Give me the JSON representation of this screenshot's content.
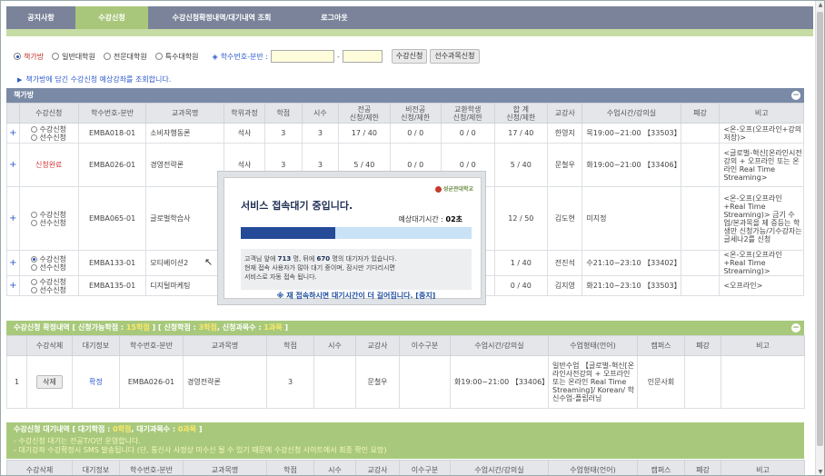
{
  "nav": {
    "tabs": [
      {
        "label": "공지사항"
      },
      {
        "label": "수강신청"
      },
      {
        "label": "수강신청확정내역/대기내역 조회"
      },
      {
        "label": "로그아웃"
      }
    ],
    "active_index": 1
  },
  "filter": {
    "radios": [
      {
        "label": "책가방",
        "checked": true
      },
      {
        "label": "일반대학원",
        "checked": false
      },
      {
        "label": "전문대학원",
        "checked": false
      },
      {
        "label": "특수대학원",
        "checked": false
      }
    ],
    "code_label": "학수번호-분반 :",
    "input1": "",
    "input2": "",
    "apply_button": "수강신청",
    "prereq_button": "선수과목신청"
  },
  "notice1": "책가방에 담긴 수강신청 예상강좌를 조회합니다.",
  "bag": {
    "title": "책가방",
    "toggle": "−",
    "headers": [
      "수강신청",
      "학수번호-분반",
      "교과목명",
      "학위과정",
      "학점",
      "시수",
      "전공\n신청/제한",
      "비전공\n신청/제한",
      "교환학생\n신청/제한",
      "합 계\n신청/제한",
      "교강사",
      "수업시간/강의실",
      "폐강",
      "비고"
    ],
    "rows": [
      {
        "state": "radio",
        "checked": "",
        "code": "EMBA018-01",
        "name": "소비자행동론",
        "course": "석사",
        "credit": "3",
        "hours": "3",
        "major": "17 / 40",
        "nonmajor": "0 / 0",
        "exchange": "0 / 0",
        "total": "17 / 40",
        "teacher": "한영지",
        "time": "목19:00~21:00 【33503】",
        "closed": "",
        "note": "<온-오프(오프라인+강의저장)>"
      },
      {
        "state": "done",
        "done_label": "신청완료",
        "code": "EMBA026-01",
        "name": "경영전략론",
        "course": "석사",
        "credit": "3",
        "hours": "3",
        "major": "5 / 40",
        "nonmajor": "0 / 0",
        "exchange": "0 / 0",
        "total": "5 / 40",
        "teacher": "문철우",
        "time": "화19:00~21:00 【33406】",
        "closed": "",
        "note": "<글로벌-혁신[온라인시전강의 + 오프라인 또는 온라인 Real Time Streaming>"
      },
      {
        "state": "radio",
        "checked": "",
        "code": "EMBA065-01",
        "name": "글로벌학습사",
        "course": "",
        "credit": "",
        "hours": "",
        "major": "",
        "nonmajor": "",
        "exchange": "",
        "total": "12 / 50",
        "teacher": "김도현",
        "time": "미지정",
        "closed": "",
        "note": "<온-오프(오프라인+Real Time Streaming)> 금기 수업/본과목을 제 증등는 학생만 신청가능/기수강자는 글세나2를 신청"
      },
      {
        "state": "radio",
        "checked": "apply",
        "code": "EMBA133-01",
        "name": "모티베이션2",
        "course": "",
        "credit": "",
        "hours": "",
        "major": "",
        "nonmajor": "",
        "exchange": "",
        "total": "1 / 40",
        "teacher": "전진석",
        "time": "수21:10~23:10 【33402】",
        "closed": "",
        "note": "<온-오프(오프라인+Real Time Streaming)>"
      },
      {
        "state": "radio",
        "checked": "",
        "code": "EMBA135-01",
        "name": "디지털마케팅",
        "course": "",
        "credit": "",
        "hours": "",
        "major": "",
        "nonmajor": "",
        "exchange": "",
        "total": "0 / 40",
        "teacher": "김지영",
        "time": "화21:10~23:10 【33503】",
        "closed": "",
        "note": "<오프라인>"
      }
    ],
    "opt_apply": "수강신청",
    "opt_prereq": "선수신청"
  },
  "confirmed": {
    "title_prefix": "수강신청 확정내역 [ 신청가능학점 :",
    "possible": "15학점",
    "mid": "] [ 신청학점 :",
    "applied": "3학점",
    "mid2": ", 신청과목수 :",
    "count": "1과목",
    "suffix": "]",
    "headers": [
      "",
      "수강삭제",
      "대기정보",
      "학수번호-분반",
      "교과목명",
      "학점",
      "시수",
      "교강사",
      "이수구분",
      "수업시간/강의실",
      "수업형태(언어)",
      "캠퍼스",
      "폐강",
      "비고"
    ],
    "rows": [
      {
        "no": "1",
        "delete_label": "삭제",
        "wait_label": "확정",
        "code": "EMBA026-01",
        "name": "경영전략론",
        "credit": "3",
        "hours": "",
        "teacher": "문철우",
        "type": "",
        "time": "화19:00~21:00 【33406】",
        "form": "일반수업 【글로벌-혁신[온라인사전강의 + 오프라인 또는 온라인 Real Time Streaming]/ Korean/ 학신수업-플립러닝",
        "campus": "인문사회",
        "closed": "",
        "note": ""
      }
    ]
  },
  "waitlist": {
    "title_prefix": "수강신청 대기내역 [ 대기학점 :",
    "wait_credit": "0학점",
    "mid": ", 대기과목수 :",
    "wait_count": "0과목",
    "suffix": "]",
    "notes": [
      "- 수강신청 대기는 전공T/O만 운영합니다.",
      "- 대기강좌 수강확정시 SMS 발송됩니다 (단, 통신사 사정상 미수신 될 수 있기 때문에 수강신청 사이트에서 최종 확인 요망)"
    ],
    "headers": [
      "수강삭제",
      "대기정보",
      "학수번호-분반",
      "교과목명",
      "학점",
      "시수",
      "교강사",
      "이수구분",
      "수업시간/강의실",
      "수업형태(언어)",
      "캠퍼스",
      "폐강",
      "비고"
    ]
  },
  "modal": {
    "logo": "성균관대학교",
    "title": "서비스 접속대기 중입니다.",
    "wait_label": "예상대기시간 :",
    "wait_time": "02초",
    "progress": 0.41,
    "line1_a": "고객님 앞에",
    "ahead": "713",
    "line1_b": "명, 뒤에",
    "behind": "670",
    "line1_c": "명의 대기자가 있습니다.",
    "line2": "현재 접속 사용자가 많아 대기 중이며, 잠시만 기다리시면",
    "line3": "서비스로 자동 접속 됩니다.",
    "reconnect": "※ 재 접속하시면 대기시간이 더 길어집니다. [중지]"
  },
  "colors": {
    "nav": "#7a8399",
    "active_tab": "#a9c77b",
    "section_blue": "#7a8aa6",
    "section_green": "#a8c97c",
    "progress_fill": "#254a97"
  }
}
